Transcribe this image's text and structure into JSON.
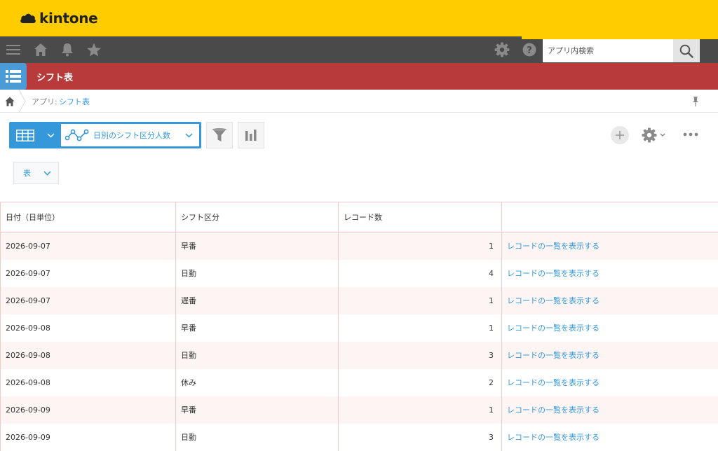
{
  "header": {
    "logo_text": "kintone"
  },
  "nav": {
    "search_placeholder": "アプリ内検索",
    "icons": [
      "menu-icon",
      "home-icon",
      "bell-icon",
      "star-icon",
      "gear-icon",
      "help-icon",
      "search-icon"
    ]
  },
  "app": {
    "title": "シフト表"
  },
  "breadcrumb": {
    "prefix": "アプリ:",
    "app_name": "シフト表"
  },
  "view": {
    "name": "日別のシフト区分人数",
    "chart_type": "表"
  },
  "table": {
    "headers": [
      "日付（日単位）",
      "シフト区分",
      "レコード数",
      ""
    ],
    "rows": [
      {
        "date": "2026-09-07",
        "shift": "早番",
        "count": "1",
        "link": "レコードの一覧を表示する"
      },
      {
        "date": "2026-09-07",
        "shift": "日勤",
        "count": "4",
        "link": "レコードの一覧を表示する"
      },
      {
        "date": "2026-09-07",
        "shift": "遅番",
        "count": "1",
        "link": "レコードの一覧を表示する"
      },
      {
        "date": "2026-09-08",
        "shift": "早番",
        "count": "1",
        "link": "レコードの一覧を表示する"
      },
      {
        "date": "2026-09-08",
        "shift": "日勤",
        "count": "3",
        "link": "レコードの一覧を表示する"
      },
      {
        "date": "2026-09-08",
        "shift": "休み",
        "count": "2",
        "link": "レコードの一覧を表示する"
      },
      {
        "date": "2026-09-09",
        "shift": "早番",
        "count": "1",
        "link": "レコードの一覧を表示する"
      },
      {
        "date": "2026-09-09",
        "shift": "日勤",
        "count": "3",
        "link": "レコードの一覧を表示する"
      }
    ]
  },
  "colors": {
    "brand_yellow": "#ffcc00",
    "nav_dark": "#4a4a4a",
    "app_red": "#b83a3a",
    "link_blue": "#3498db"
  }
}
